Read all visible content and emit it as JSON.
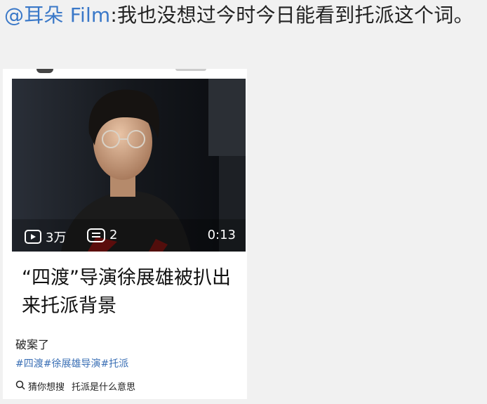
{
  "post": {
    "mention": "@耳朵 Film",
    "text": ":我也没想过今时今日能看到托派这个词。"
  },
  "card": {
    "video": {
      "views": "3万",
      "comments": "2",
      "duration": "0:13",
      "title": "“四渡”导演徐展雄被扒出来托派背景"
    },
    "caption": "破案了",
    "tags": [
      "#四渡",
      "#徐展雄导演",
      "#托派"
    ],
    "search_prefix": "猜你想搜",
    "search_suggestion": "托派是什么意思"
  },
  "icons": {
    "views": "play-icon",
    "comments": "comment-icon",
    "search": "search-icon"
  },
  "colors": {
    "mention": "#3a78c8",
    "tags": "#3a6fb5",
    "thumbnail_bg": "#111111"
  }
}
